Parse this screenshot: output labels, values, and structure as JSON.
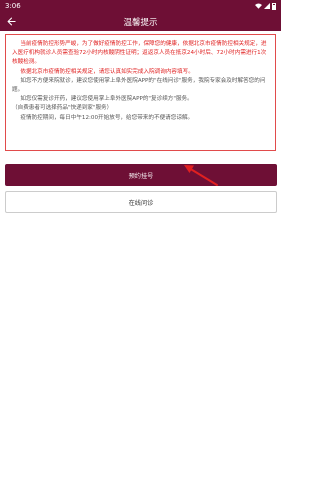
{
  "status_bar": {
    "time": "3:06"
  },
  "header": {
    "title": "温馨提示"
  },
  "notice": {
    "red_paragraphs": [
      "当前疫情防控形势严峻，为了做好疫情防控工作，保障您的健康，依据北京市疫情防控相关规定，进入医疗机构就诊人员需查验72小时内核酸阴性证明；返返京人员在抵京24小时后、72小时内需进行1次核酸检测。",
      "依据北京市疫情防控相关规定，请您认真如实完成入院调询内容填写。"
    ],
    "gray_paragraphs": [
      "如您不方便来院就诊，建议您使用掌上阜外医院APP的\"在线问诊\"服务，我院专家会及时解答您的问题。",
      "如您仅需复诊开药，建议您使用掌上阜外医院APP的\"复诊续方\"服务。",
      "（自费患者可选择药品\"快递到家\"服务）",
      "疫情防控期间，每日中午12:00开始放号，给您带来的不便请您谅解。"
    ]
  },
  "buttons": {
    "primary_label": "预约挂号",
    "secondary_label": "在线问诊"
  },
  "colors": {
    "brand": "#6e0f35",
    "notice_text": "#e02020",
    "annotation_arrow": "#e02020"
  }
}
